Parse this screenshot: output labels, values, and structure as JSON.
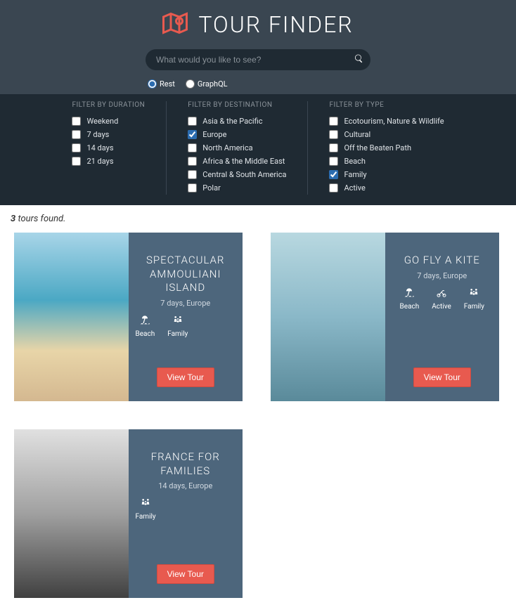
{
  "header": {
    "title": "TOUR FINDER",
    "search_placeholder": "What would you like to see?"
  },
  "api": {
    "rest_label": "Rest",
    "graphql_label": "GraphQL",
    "selected": "rest"
  },
  "filters": {
    "duration": {
      "title": "FILTER BY DURATION",
      "items": [
        {
          "label": "Weekend",
          "checked": false
        },
        {
          "label": "7 days",
          "checked": false
        },
        {
          "label": "14 days",
          "checked": false
        },
        {
          "label": "21 days",
          "checked": false
        }
      ]
    },
    "destination": {
      "title": "FILTER BY DESTINATION",
      "items": [
        {
          "label": "Asia & the Pacific",
          "checked": false
        },
        {
          "label": "Europe",
          "checked": true
        },
        {
          "label": "North America",
          "checked": false
        },
        {
          "label": "Africa & the Middle East",
          "checked": false
        },
        {
          "label": "Central & South America",
          "checked": false
        },
        {
          "label": "Polar",
          "checked": false
        }
      ]
    },
    "type": {
      "title": "FILTER BY TYPE",
      "items": [
        {
          "label": "Ecotourism, Nature & Wildlife",
          "checked": false
        },
        {
          "label": "Cultural",
          "checked": false
        },
        {
          "label": "Off the Beaten Path",
          "checked": false
        },
        {
          "label": "Beach",
          "checked": false
        },
        {
          "label": "Family",
          "checked": true
        },
        {
          "label": "Active",
          "checked": false
        }
      ]
    }
  },
  "results": {
    "count": "3",
    "label": " tours found."
  },
  "tours": [
    {
      "title": "SPECTACULAR AMMOULIANI ISLAND",
      "meta": "7 days, Europe",
      "tags": [
        "Beach",
        "Family"
      ],
      "view_label": "View Tour",
      "img_class": "img-beach"
    },
    {
      "title": "GO FLY A KITE",
      "meta": "7 days, Europe",
      "tags": [
        "Beach",
        "Active",
        "Family"
      ],
      "view_label": "View Tour",
      "img_class": "img-kite"
    },
    {
      "title": "FRANCE FOR FAMILIES",
      "meta": "14 days, Europe",
      "tags": [
        "Family"
      ],
      "view_label": "View Tour",
      "img_class": "img-paris"
    }
  ],
  "icons": {
    "Beach": "beach",
    "Family": "family",
    "Active": "active"
  }
}
